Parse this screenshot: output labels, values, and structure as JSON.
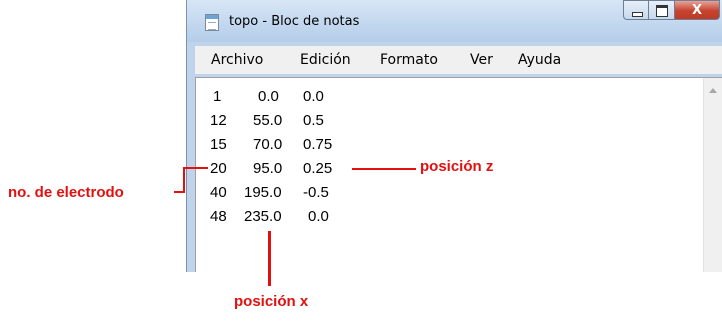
{
  "window": {
    "title": "topo - Bloc de notas",
    "close_glyph": "X"
  },
  "menu": [
    "Archivo",
    "Edición",
    "Formato",
    "Ver",
    "Ayuda"
  ],
  "lines": [
    [
      "1",
      "0.0",
      "0.0"
    ],
    [
      "12",
      "55.0",
      "0.5"
    ],
    [
      "15",
      "70.0",
      "0.75"
    ],
    [
      "20",
      "95.0",
      "0.25"
    ],
    [
      "40",
      "195.0",
      "-0.5"
    ],
    [
      "48",
      "235.0",
      "0.0"
    ]
  ],
  "annotations": {
    "electrode": "no. de electrodo",
    "z": "posición z",
    "x": "posición x"
  },
  "colors": {
    "annotation": "#e31010"
  }
}
